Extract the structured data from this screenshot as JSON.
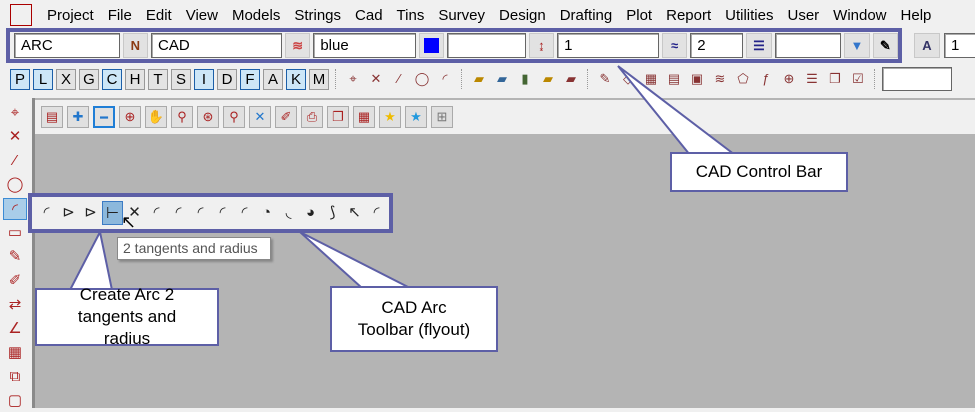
{
  "menu": [
    "Project",
    "File",
    "Edit",
    "View",
    "Models",
    "Strings",
    "Cad",
    "Tins",
    "Survey",
    "Design",
    "Drafting",
    "Plot",
    "Report",
    "Utilities",
    "User",
    "Window",
    "Help"
  ],
  "control_bar": {
    "string_type": "ARC",
    "name_icon": "N",
    "model": "CAD",
    "colour": "blue",
    "colour_hex": "#0000ff",
    "height": "",
    "weight": "1",
    "linestyle_value": "2",
    "text_height": "1"
  },
  "letter_toggles": [
    {
      "l": "P",
      "on": true
    },
    {
      "l": "L",
      "on": true
    },
    {
      "l": "X",
      "on": false
    },
    {
      "l": "G",
      "on": false
    },
    {
      "l": "C",
      "on": true
    },
    {
      "l": "H",
      "on": false
    },
    {
      "l": "T",
      "on": false
    },
    {
      "l": "S",
      "on": false
    },
    {
      "l": "I",
      "on": true
    },
    {
      "l": "D",
      "on": false
    },
    {
      "l": "F",
      "on": true
    },
    {
      "l": "A",
      "on": false
    },
    {
      "l": "K",
      "on": true
    },
    {
      "l": "M",
      "on": false
    }
  ],
  "tooltip": "2 tangents and radius",
  "callouts": {
    "control_bar": "CAD Control Bar",
    "arc_button": "Create Arc 2 tangents and radius",
    "arc_toolbar": "CAD Arc Toolbar (flyout)"
  },
  "accent": "#5d5fa6"
}
